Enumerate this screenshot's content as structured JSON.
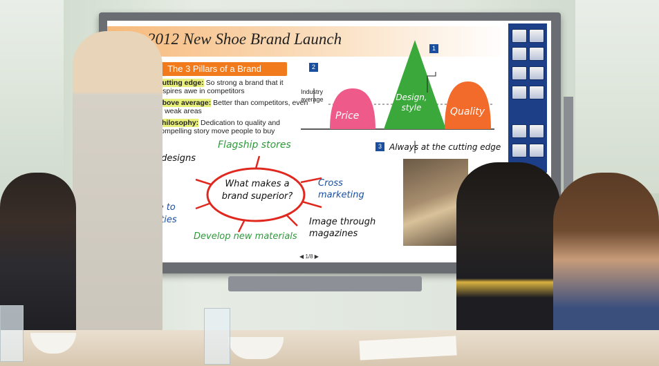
{
  "slide": {
    "title": "2012 New Shoe Brand Launch",
    "section_header": "The 3 Pillars of a Brand",
    "pillars": [
      {
        "num": "1",
        "label": "Cutting edge:",
        "text": "So strong a brand that it inspires awe in competitors"
      },
      {
        "num": "2",
        "label": "Above average:",
        "text": "Better than competitors, even in weak areas"
      },
      {
        "num": "3",
        "label": "Philosophy:",
        "text": "Dedication to quality and compelling story move people to buy"
      }
    ],
    "diagram": {
      "industry_label": "Industry average",
      "callout_1": "1",
      "callout_2": "2",
      "callout_3": "3",
      "price": "Price",
      "design": "Design, style",
      "quality": "Quality",
      "cutting_edge": "Always at the cutting edge"
    },
    "mindmap": {
      "center": "What makes a brand superior?",
      "flagship": "Flagship stores",
      "cross": "Cross marketing",
      "image": "Image through magazines",
      "develop": "Develop new materials",
      "left_top": "o designs ta",
      "left_bottom": "ure to brities"
    },
    "pager": "1/8"
  },
  "colors": {
    "accent_orange": "#f07a1c",
    "accent_blue": "#1a4fa0",
    "pink": "#ee5b8a",
    "green": "#3aa83a",
    "orange_blob": "#f26b2a"
  }
}
